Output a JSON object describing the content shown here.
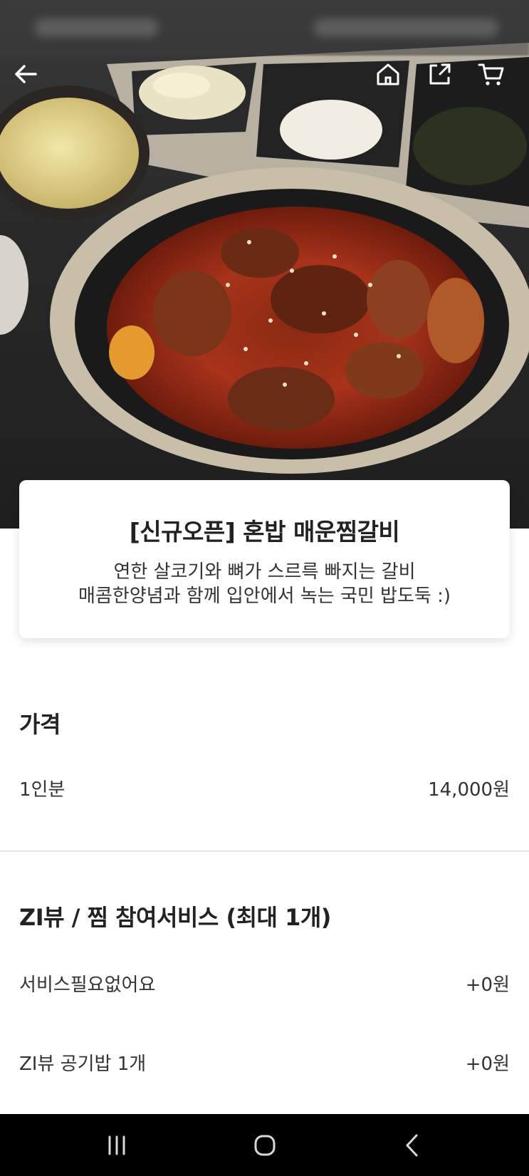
{
  "header": {
    "icons": [
      "back-arrow-icon",
      "home-icon",
      "share-icon",
      "cart-icon"
    ]
  },
  "product": {
    "title": "[신규오픈] 혼밥 매운찜갈비",
    "description_line1": "연한 살코기와 뼈가 스르륵 빠지는 갈비",
    "description_line2": "매콤한양념과 함께 입안에서 녹는 국민 밥도둑 :)"
  },
  "price_section": {
    "title": "가격",
    "option_label": "1인분",
    "option_price": "14,000원"
  },
  "review_section": {
    "title": "ZI뷰 / 찜 참여서비스 (최대 1개)",
    "options": [
      {
        "label": "서비스필요없어요",
        "price": "+0원"
      },
      {
        "label": "ZI뷰 공기밥 1개",
        "price": "+0원"
      }
    ]
  },
  "navbar": {
    "icons": [
      "recent-apps-icon",
      "home-nav-icon",
      "back-nav-icon"
    ]
  }
}
